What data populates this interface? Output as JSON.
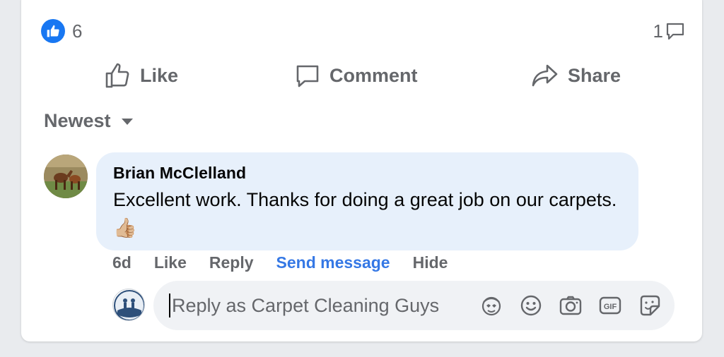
{
  "post": {
    "reaction_count": "6",
    "comment_count": "1"
  },
  "actions": {
    "like": "Like",
    "comment": "Comment",
    "share": "Share"
  },
  "sort": {
    "label": "Newest"
  },
  "comment": {
    "author": "Brian McClelland",
    "text": "Excellent work. Thanks for doing a great job on our carpets. 👍🏼",
    "time": "6d",
    "like": "Like",
    "reply": "Reply",
    "send_message": "Send message",
    "hide": "Hide"
  },
  "reply": {
    "placeholder": "Reply as Carpet Cleaning Guys"
  },
  "colors": {
    "accent": "#1877f2",
    "link": "#3578e5",
    "bubble": "#e7f0fb",
    "secondary_text": "#65676b"
  },
  "icons": [
    "like-icon",
    "comment-icon",
    "share-icon",
    "dropdown-icon",
    "avatar-emoji-icon",
    "emoji-icon",
    "camera-icon",
    "gif-icon",
    "sticker-icon"
  ]
}
